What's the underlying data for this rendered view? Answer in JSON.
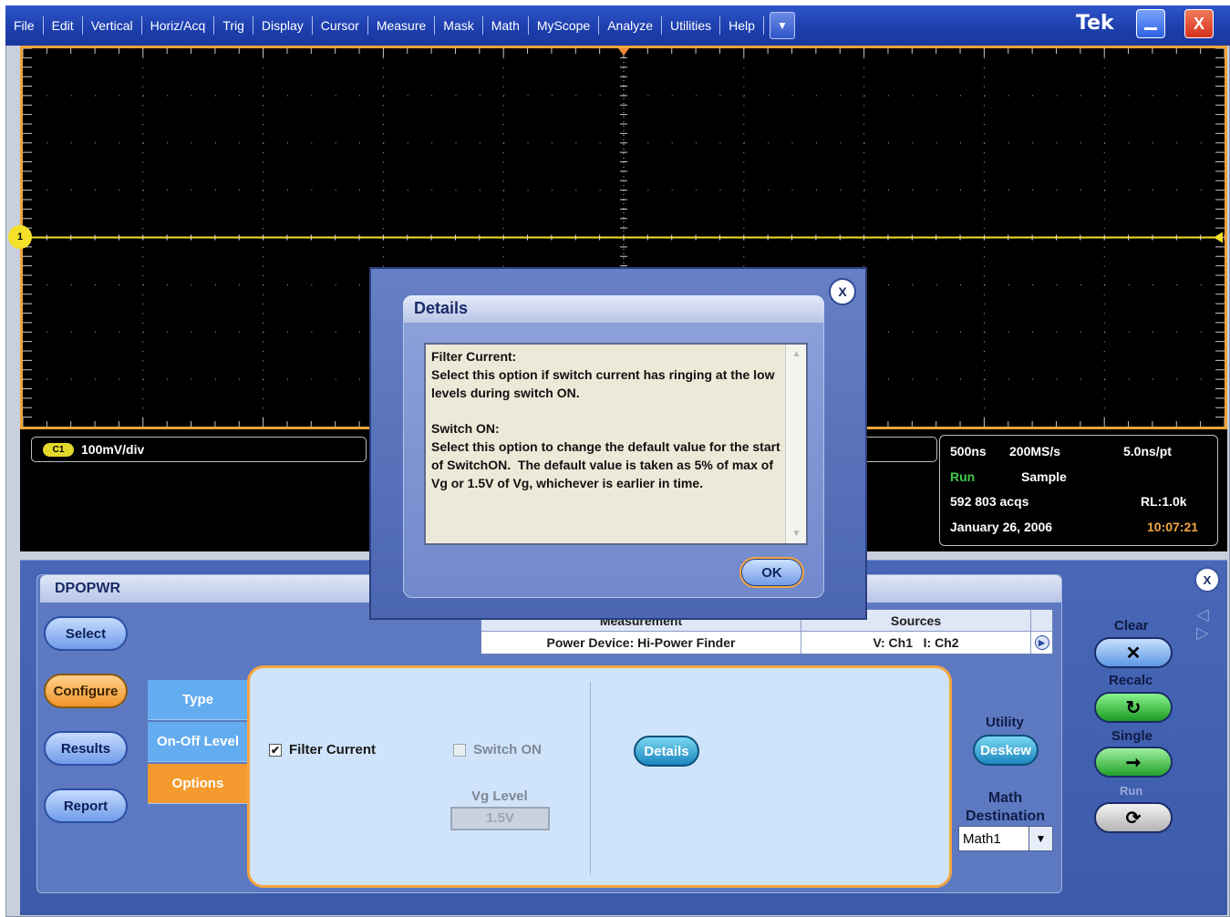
{
  "menu": {
    "items": [
      "File",
      "Edit",
      "Vertical",
      "Horiz/Acq",
      "Trig",
      "Display",
      "Cursor",
      "Measure",
      "Mask",
      "Math",
      "MyScope",
      "Analyze",
      "Utilities",
      "Help"
    ],
    "dropdown_icon": "chevron-down-icon",
    "brand": "Tek",
    "minimize_icon": "minimize-icon",
    "close_icon": "close-icon",
    "close_glyph": "X",
    "dropdown_glyph": "▼"
  },
  "scope": {
    "channel_marker": "1",
    "channel_badge": "C1",
    "channel_scale": "100mV/div",
    "grid_color": "#f0a43a",
    "trace_color": "#f3e12a"
  },
  "acquisition": {
    "time_div": "500ns",
    "sample_rate": "200MS/s",
    "resolution": "5.0ns/pt",
    "state": "Run",
    "mode": "Sample",
    "acqs": "592 803 acqs",
    "record_length": "RL:1.0k",
    "date": "January 26, 2006",
    "time": "10:07:21"
  },
  "panel": {
    "title": "DPOPWR",
    "nav": [
      "Select",
      "Configure",
      "Results",
      "Report"
    ],
    "active_nav": "Configure",
    "table": {
      "headers": [
        "Measurement",
        "Sources"
      ],
      "rows": [
        {
          "measurement": "Power Device: Hi-Power Finder",
          "sources": "V: Ch1   I: Ch2"
        }
      ]
    },
    "tabs": [
      "Type",
      "On-Off Level",
      "Options"
    ],
    "active_tab": "Options",
    "filter_current_label": "Filter Current",
    "filter_current_checked": true,
    "switch_on_label": "Switch ON",
    "switch_on_checked": false,
    "vg_level_label": "Vg Level",
    "vg_level_value": "1.5V",
    "details_button": "Details",
    "utility_label": "Utility",
    "deskew_button": "Deskew",
    "math_destination_label": "Math Destination",
    "math_destination_value": "Math1",
    "clear_label": "Clear",
    "recalc_label": "Recalc",
    "single_label": "Single",
    "run_label": "Run",
    "close_glyph": "X",
    "accent_color": "#f3a540"
  },
  "dialog": {
    "title": "Details",
    "body": "Filter Current:\nSelect this option if switch current has ringing at the low levels during switch ON.\n\nSwitch ON:\nSelect this option to change the default value for the start of SwitchON.  The default value is taken as 5% of max of Vg or 1.5V of Vg, whichever is earlier in time.",
    "ok_button": "OK",
    "close_glyph": "X"
  }
}
